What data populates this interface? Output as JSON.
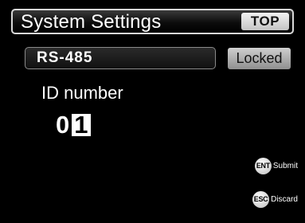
{
  "header": {
    "title": "System Settings",
    "top_button_label": "TOP"
  },
  "mode": {
    "value": "RS-485",
    "status_label": "Locked"
  },
  "id_field": {
    "label": "ID number",
    "digits": [
      "0",
      "1"
    ],
    "cursor_index": 1
  },
  "softkeys": {
    "enter": {
      "key": "ENT",
      "label": "Submit"
    },
    "escape": {
      "key": "ESC",
      "label": "Discard"
    }
  },
  "colors": {
    "background": "#000000",
    "text": "#ffffff",
    "button_face": "#dcdcdc"
  }
}
